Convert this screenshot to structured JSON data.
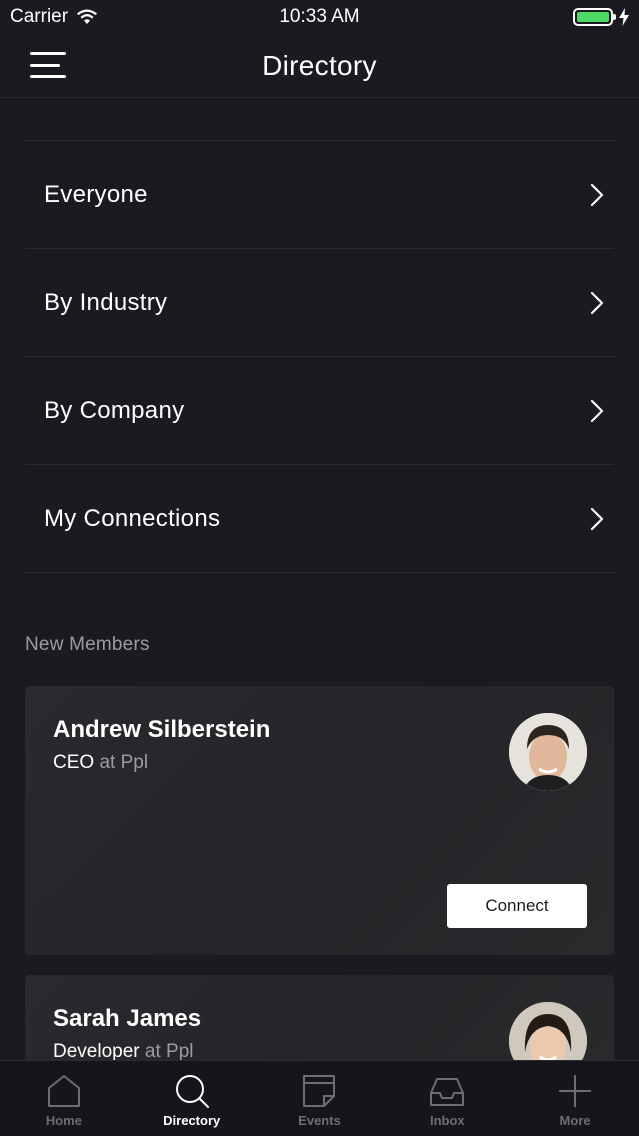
{
  "status_bar": {
    "carrier": "Carrier",
    "time": "10:33 AM"
  },
  "nav": {
    "title": "Directory"
  },
  "menu": {
    "items": [
      {
        "label": "Everyone"
      },
      {
        "label": "By Industry"
      },
      {
        "label": "By Company"
      },
      {
        "label": "My Connections"
      }
    ]
  },
  "new_members": {
    "header": "New Members",
    "members": [
      {
        "name": "Andrew Silberstein",
        "title": "CEO",
        "at": "at",
        "company": "Ppl",
        "connect_label": "Connect"
      },
      {
        "name": "Sarah James",
        "title": "Developer",
        "at": "at",
        "company": "Ppl"
      }
    ]
  },
  "tab_bar": {
    "tabs": [
      {
        "label": "Home",
        "icon": "home-icon"
      },
      {
        "label": "Directory",
        "icon": "search-icon"
      },
      {
        "label": "Events",
        "icon": "events-icon"
      },
      {
        "label": "Inbox",
        "icon": "inbox-icon"
      },
      {
        "label": "More",
        "icon": "plus-icon"
      }
    ],
    "active": "Directory"
  },
  "colors": {
    "background": "#1b1a20",
    "divider": "#2c2b31",
    "muted_text": "#9c9ba1",
    "battery": "#4cd964"
  }
}
